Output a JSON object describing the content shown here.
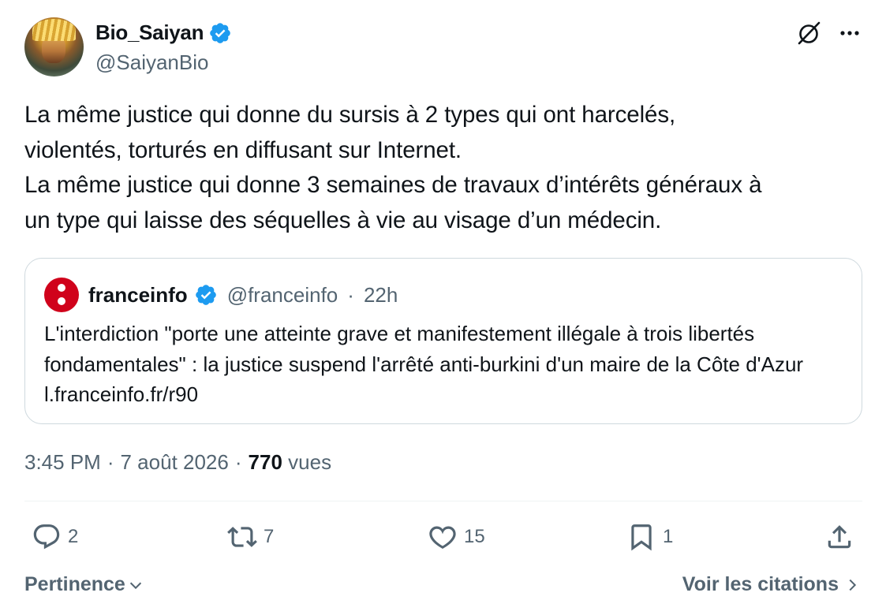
{
  "author": {
    "display_name": "Bio_Saiyan",
    "handle": "@SaiyanBio"
  },
  "tweet": {
    "text": "La même justice qui donne du sursis à 2 types qui ont harcelés,\nviolentés, torturés en diffusant sur Internet.\nLa même justice qui donne 3 semaines de travaux d’intérêts généraux à\nun type qui laisse des séquelles à vie au visage d’un médecin."
  },
  "quote": {
    "display_name": "franceinfo",
    "handle": "@franceinfo",
    "separator": "·",
    "time": "22h",
    "text": "L'interdiction \"porte une atteinte grave et manifestement illégale à trois libertés fondamentales\" : la justice suspend l'arrêté anti-burkini d'un maire de la Côte d'Azur l.franceinfo.fr/r90"
  },
  "meta": {
    "time": "3:45 PM",
    "sep1": "·",
    "date": "7 août 2026",
    "sep2": "·",
    "views_count": "770",
    "views_label": "vues"
  },
  "actions": {
    "replies": "2",
    "reposts": "7",
    "likes": "15",
    "bookmarks": "1"
  },
  "footer": {
    "sort_label": "Pertinence",
    "quotes_label": "Voir les citations"
  },
  "colors": {
    "verified": "#1d9bf0",
    "secondary_text": "#536471",
    "primary_text": "#0f1419",
    "border": "#cfd9de",
    "franceinfo_red": "#d0021b"
  },
  "icons": [
    "verified-badge-icon",
    "grok-icon",
    "more-icon",
    "reply-icon",
    "repost-icon",
    "like-icon",
    "bookmark-icon",
    "share-icon",
    "chevron-down-icon",
    "chevron-right-icon"
  ]
}
